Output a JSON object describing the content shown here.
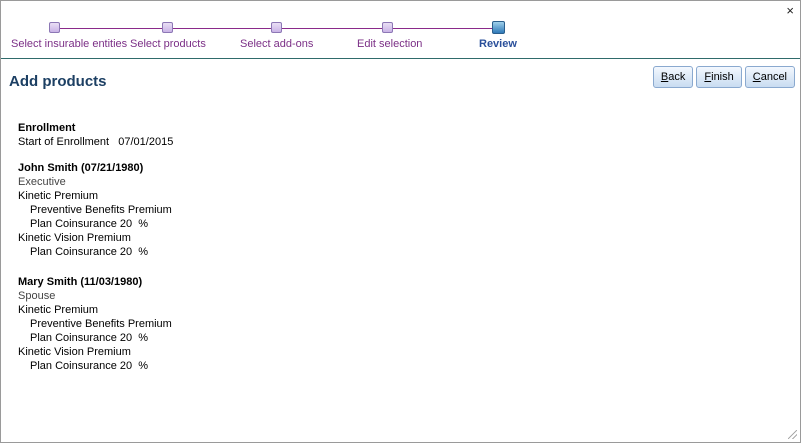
{
  "window": {
    "close_glyph": "×"
  },
  "stepper": {
    "steps": [
      {
        "label": "Select insurable entities"
      },
      {
        "label": "Select products"
      },
      {
        "label": "Select add-ons"
      },
      {
        "label": "Edit selection"
      },
      {
        "label": "Review"
      }
    ]
  },
  "header": {
    "title": "Add products"
  },
  "buttons": {
    "back": {
      "key": "B",
      "rest": "ack"
    },
    "finish": {
      "key": "F",
      "rest": "inish"
    },
    "cancel": {
      "key": "C",
      "rest": "ancel"
    }
  },
  "enrollment": {
    "title": "Enrollment",
    "start_label": "Start of Enrollment",
    "start_value": "07/01/2015"
  },
  "members": [
    {
      "name": "John Smith (07/21/1980)",
      "role": "Executive",
      "products": [
        {
          "name": "Kinetic Premium",
          "lines": [
            "Preventive Benefits Premium",
            "Plan Coinsurance 20  %"
          ]
        },
        {
          "name": "Kinetic Vision Premium",
          "lines": [
            "Plan Coinsurance 20  %"
          ]
        }
      ]
    },
    {
      "name": "Mary Smith (11/03/1980)",
      "role": "Spouse",
      "products": [
        {
          "name": "Kinetic Premium",
          "lines": [
            "Preventive Benefits Premium",
            "Plan Coinsurance 20  %"
          ]
        },
        {
          "name": "Kinetic Vision Premium",
          "lines": [
            "Plan Coinsurance 20  %"
          ]
        }
      ]
    }
  ],
  "colors": {
    "step_label": "#7b2f86",
    "step_active": "#2a4f9a",
    "title": "#1c3f63",
    "divider": "#2f6b6b"
  }
}
